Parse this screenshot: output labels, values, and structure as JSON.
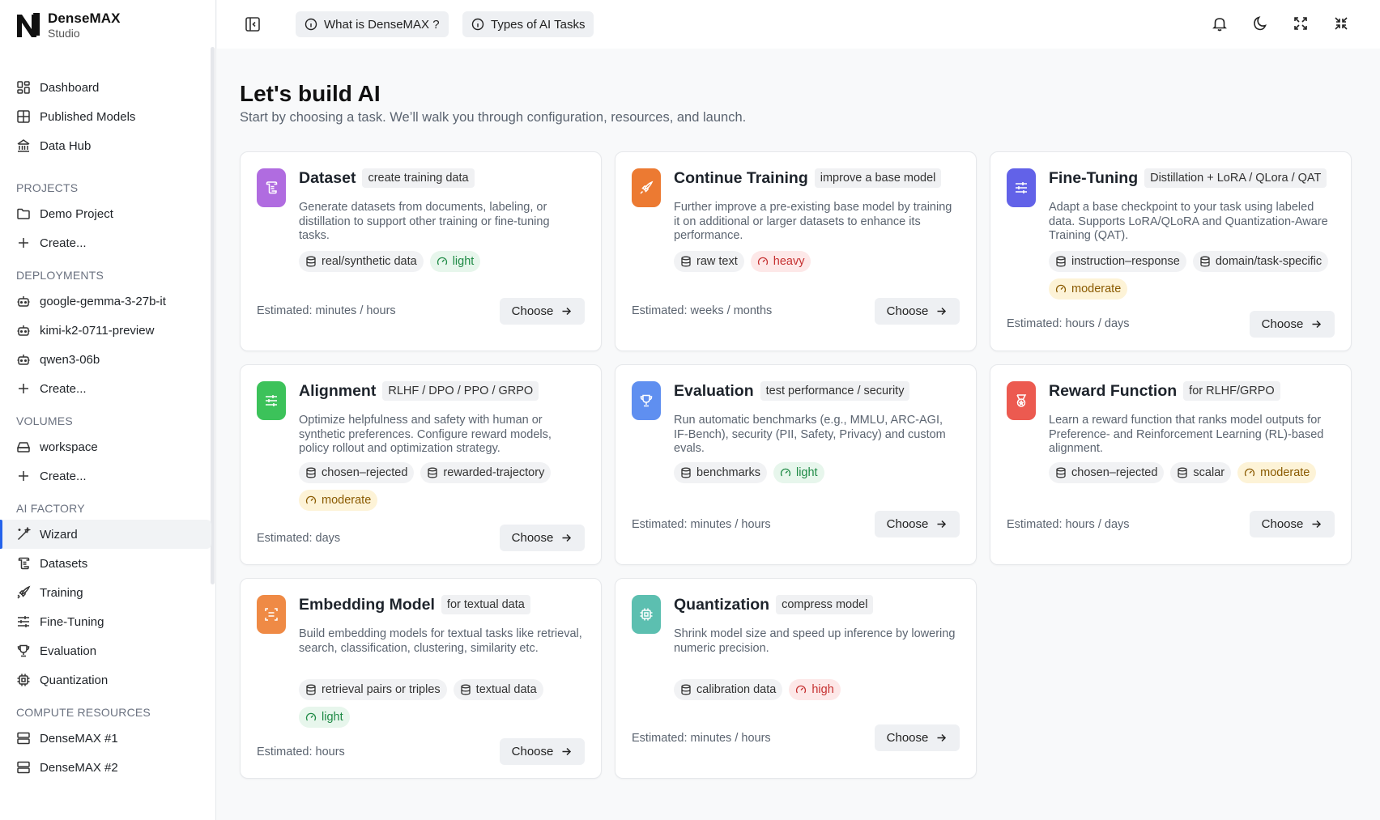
{
  "brand": {
    "name": "DenseMAX",
    "sub": "Studio"
  },
  "sidebar": {
    "top": [
      {
        "label": "Dashboard",
        "icon": "dashboard-icon"
      },
      {
        "label": "Published Models",
        "icon": "grid-icon"
      },
      {
        "label": "Data Hub",
        "icon": "library-icon"
      }
    ],
    "projects": {
      "title": "PROJECTS",
      "items": [
        "Demo Project",
        "Create..."
      ]
    },
    "deployments": {
      "title": "DEPLOYMENTS",
      "items": [
        "google-gemma-3-27b-it",
        "kimi-k2-0711-preview",
        "qwen3-06b",
        "Create..."
      ]
    },
    "volumes": {
      "title": "VOLUMES",
      "items": [
        "workspace",
        "Create..."
      ]
    },
    "ai_factory": {
      "title": "AI FACTORY",
      "items": [
        "Wizard",
        "Datasets",
        "Training",
        "Fine-Tuning",
        "Evaluation",
        "Quantization"
      ]
    },
    "compute": {
      "title": "COMPUTE RESOURCES",
      "items": [
        "DenseMAX #1",
        "DenseMAX #2"
      ]
    }
  },
  "topbar": {
    "what_is": "What is DenseMAX ?",
    "types": "Types of AI Tasks"
  },
  "main": {
    "title": "Let's build AI",
    "subtitle": "Start by choosing a task. We’ll walk you through configuration, resources, and launch."
  },
  "cards": [
    {
      "title": "Dataset",
      "tag": "create training data",
      "desc": "Generate datasets from documents, labeling, or distillation to support other training or fine-tuning tasks.",
      "chips": [
        "real/synthetic data"
      ],
      "level": "light",
      "estimate": "Estimated: minutes / hours",
      "choose": "Choose",
      "color": "#b06ce0"
    },
    {
      "title": "Continue Training",
      "tag": "improve a base model",
      "desc": "Further improve a pre-existing base model by training it on additional or larger datasets to enhance its performance.",
      "chips": [
        "raw text"
      ],
      "level": "heavy",
      "estimate": "Estimated: weeks / months",
      "choose": "Choose",
      "color": "#ec7a32"
    },
    {
      "title": "Fine-Tuning",
      "tag": "Distillation + LoRA / QLora / QAT",
      "desc": "Adapt a base checkpoint to your task using labeled data. Supports LoRA/QLoRA and Quantization-Aware Training (QAT).",
      "chips": [
        "instruction–response",
        "domain/task-specific"
      ],
      "level": "moderate",
      "estimate": "Estimated: hours / days",
      "choose": "Choose",
      "color": "#6262e8"
    },
    {
      "title": "Alignment",
      "tag": "RLHF / DPO / PPO / GRPO",
      "desc": "Optimize helpfulness and safety with human or synthetic preferences. Configure reward models, policy rollout and optimization strategy.",
      "chips": [
        "chosen–rejected",
        "rewarded-trajectory"
      ],
      "level": "moderate",
      "estimate": "Estimated: days",
      "choose": "Choose",
      "color": "#3cc25a"
    },
    {
      "title": "Evaluation",
      "tag": "test performance / security",
      "desc": "Run automatic benchmarks (e.g., MMLU, ARC-AGI, IF-Bench), security (PII, Safety, Privacy) and custom evals.",
      "chips": [
        "benchmarks"
      ],
      "level": "light",
      "estimate": "Estimated: minutes / hours",
      "choose": "Choose",
      "color": "#5f8ff0"
    },
    {
      "title": "Reward Function",
      "tag": "for RLHF/GRPO",
      "desc": "Learn a reward function that ranks model outputs for Preference- and Reinforcement Learning (RL)-based alignment.",
      "chips": [
        "chosen–rejected",
        "scalar"
      ],
      "level": "moderate",
      "estimate": "Estimated: hours / days",
      "choose": "Choose",
      "color": "#ec5a50"
    },
    {
      "title": "Embedding Model",
      "tag": "for textual data",
      "desc": "Build embedding models for textual tasks like retrieval, search, classification, clustering, similarity etc.",
      "chips": [
        "retrieval pairs or triples",
        "textual data"
      ],
      "level": "light",
      "estimate": "Estimated: hours",
      "choose": "Choose",
      "color": "#ef8a45"
    },
    {
      "title": "Quantization",
      "tag": "compress model",
      "desc": "Shrink model size and speed up inference by lowering numeric precision.",
      "chips": [
        "calibration data"
      ],
      "level": "high",
      "estimate": "Estimated: minutes / hours",
      "choose": "Choose",
      "color": "#5cbfb0"
    }
  ],
  "level_colors": {
    "light": "green",
    "heavy": "red",
    "high": "red",
    "moderate": "yellow"
  }
}
